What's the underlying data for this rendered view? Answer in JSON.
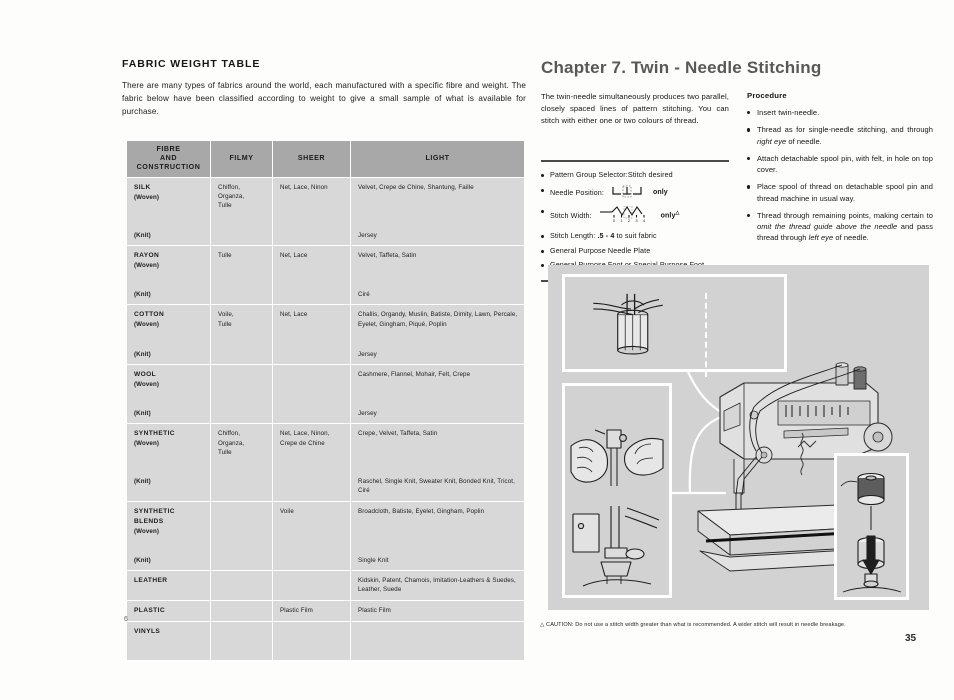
{
  "left_page": {
    "section_title": "FABRIC WEIGHT TABLE",
    "intro": "There are many types of fabrics around the world, each manufactured with a specific fibre and weight. The fabric below have been classified according to weight to give a small sample of what is available for purchase.",
    "folio": "6",
    "table": {
      "headers": [
        "FIBRE AND CONSTRUCTION",
        "FILMY",
        "SHEER",
        "LIGHT"
      ],
      "header_lines": [
        [
          "FIBRE",
          "AND",
          "CONSTRUCTION"
        ],
        [
          "FILMY"
        ],
        [
          "SHEER"
        ],
        [
          "LIGHT"
        ]
      ],
      "rows": [
        {
          "fibre": "SILK",
          "sub_woven": "(Woven)",
          "sub_knit": "(Knit)",
          "woven": {
            "filmy": "Chiffon,\nOrganza,\nTulle",
            "sheer": "Net, Lace, Ninon",
            "light": "Velvet, Crepe de Chine, Shantung, Faille"
          },
          "knit": {
            "filmy": "",
            "sheer": "",
            "light": "Jersey"
          }
        },
        {
          "fibre": "RAYON",
          "sub_woven": "(Woven)",
          "sub_knit": "(Knit)",
          "woven": {
            "filmy": "Tulle",
            "sheer": "Net, Lace",
            "light": "Velvet, Taffeta, Satin"
          },
          "knit": {
            "filmy": "",
            "sheer": "",
            "light": "Ciré"
          }
        },
        {
          "fibre": "COTTON",
          "sub_woven": "(Woven)",
          "sub_knit": "(Knit)",
          "woven": {
            "filmy": "Voile,\nTulle",
            "sheer": "Net, Lace",
            "light": "Challis, Organdy, Muslin, Batiste, Dimity, Lawn, Percale, Eyelet, Gingham, Piqué, Poplin"
          },
          "knit": {
            "filmy": "",
            "sheer": "",
            "light": "Jersey"
          }
        },
        {
          "fibre": "WOOL",
          "sub_woven": "(Woven)",
          "sub_knit": "(Knit)",
          "woven": {
            "filmy": "",
            "sheer": "",
            "light": "Cashmere, Flannel, Mohair, Felt, Crepe"
          },
          "knit": {
            "filmy": "",
            "sheer": "",
            "light": "Jersey"
          }
        },
        {
          "fibre": "SYNTHETIC",
          "sub_woven": "(Woven)",
          "sub_knit": "(Knit)",
          "woven": {
            "filmy": "Chiffon,\nOrganza,\nTulle",
            "sheer": "Net, Lace, Ninon,\nCrepe de Chine",
            "light": "Crepe, Velvet, Taffeta, Satin"
          },
          "knit": {
            "filmy": "",
            "sheer": "",
            "light": "Raschel, Single Knit, Sweater Knit, Bonded Knit, Tricot, Ciré"
          }
        },
        {
          "fibre": "SYNTHETIC BLENDS",
          "sub_woven": "(Woven)",
          "sub_knit": "(Knit)",
          "woven": {
            "filmy": "",
            "sheer": "Voile",
            "light": "Broadcloth, Batiste, Eyelet, Gingham, Poplin"
          },
          "knit": {
            "filmy": "",
            "sheer": "",
            "light": "Single Knit"
          }
        }
      ],
      "simple_rows": [
        {
          "fibre": "LEATHER",
          "filmy": "",
          "sheer": "",
          "light": "Kidskin, Patent, Chamois, Imitation-Leathers & Suedes, Leather, Suede"
        },
        {
          "fibre": "PLASTIC",
          "filmy": "",
          "sheer": "Plastic Film",
          "light": "Plastic Film"
        },
        {
          "fibre": "VINYLS",
          "filmy": "",
          "sheer": "",
          "light": ""
        }
      ]
    }
  },
  "right_page": {
    "chapter_title": "Chapter 7. Twin - Needle Stitching",
    "intro": "The twin-needle simultaneously produces two parallel, closely spaced lines of pattern stitching. You can stitch with either one or two colours of thread.",
    "settings": [
      {
        "label": "Pattern Group Selector:",
        "value": "Stitch desired",
        "icon": ""
      },
      {
        "label": "Needle Position:",
        "value": "",
        "icon": "needle-position-icon",
        "suffix": "only"
      },
      {
        "label": "Stitch Width:",
        "value": "",
        "icon": "stitch-width-icon",
        "suffix": "only",
        "suffix_mark": "△"
      },
      {
        "label": "Stitch Length:",
        "value": ".5 - 4 to suit fabric",
        "icon": ""
      },
      {
        "label": "General Purpose Needle Plate",
        "value": "",
        "icon": ""
      },
      {
        "label": "General Purpose Foot or Special Purpose Foot",
        "value": "",
        "icon": ""
      }
    ],
    "stitch_width_scale": [
      "0",
      "1",
      "2",
      "3",
      "4"
    ],
    "procedure_heading": "Procedure",
    "procedure": [
      "Insert twin-needle.",
      "Thread as for single-needle stitching, and through right eye of needle.",
      "Attach detachable spool pin, with felt, in hole on top cover.",
      "Place spool of thread on detachable spool pin and thread machine in usual way.",
      "Thread through remaining points, making certain to omit the thread guide above the needle and pass thread through left eye of needle."
    ],
    "caution": "△ CAUTION: Do not use a stitch width greater than what is recommended. A wider stitch will result in needle breakage.",
    "folio": "35",
    "illustration": {
      "inset_top_left": "twin-needle-threading-closeup",
      "inset_top_right": "needle-clamp-detail",
      "inset_left_upper": "hands-inserting-needle",
      "inset_left_lower": "presser-foot-twin-needle",
      "inset_right": "detachable-spool-pin",
      "main": "sewing-machine-overview"
    }
  },
  "colors": {
    "table_header_fill": "#a8a8a8",
    "table_cell_fill": "#d8d8d8",
    "grid_line": "#ffffff",
    "panel_fill": "#d2d2d2",
    "heading_grey": "#585858",
    "rule_dark": "#4a4a4a"
  }
}
